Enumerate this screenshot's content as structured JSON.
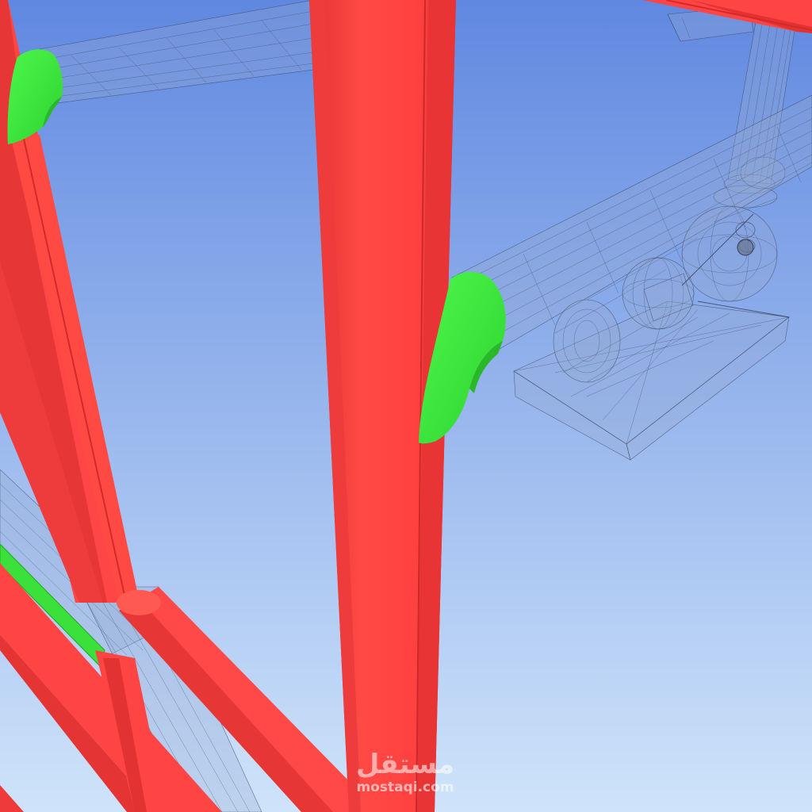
{
  "scene": {
    "background_top": "#6088e0",
    "background_bottom": "#cfe4fa",
    "frame_color": "#ff4444",
    "frame_shade": "#e83434",
    "frame_highlight": "#ff6a5e",
    "joint_color": "#44ee44",
    "joint_shade": "#2bc82b",
    "wireframe_color": "#3f4a66"
  },
  "watermark": {
    "logo_text": "مستقل",
    "url_text": "mostaqi.com"
  }
}
